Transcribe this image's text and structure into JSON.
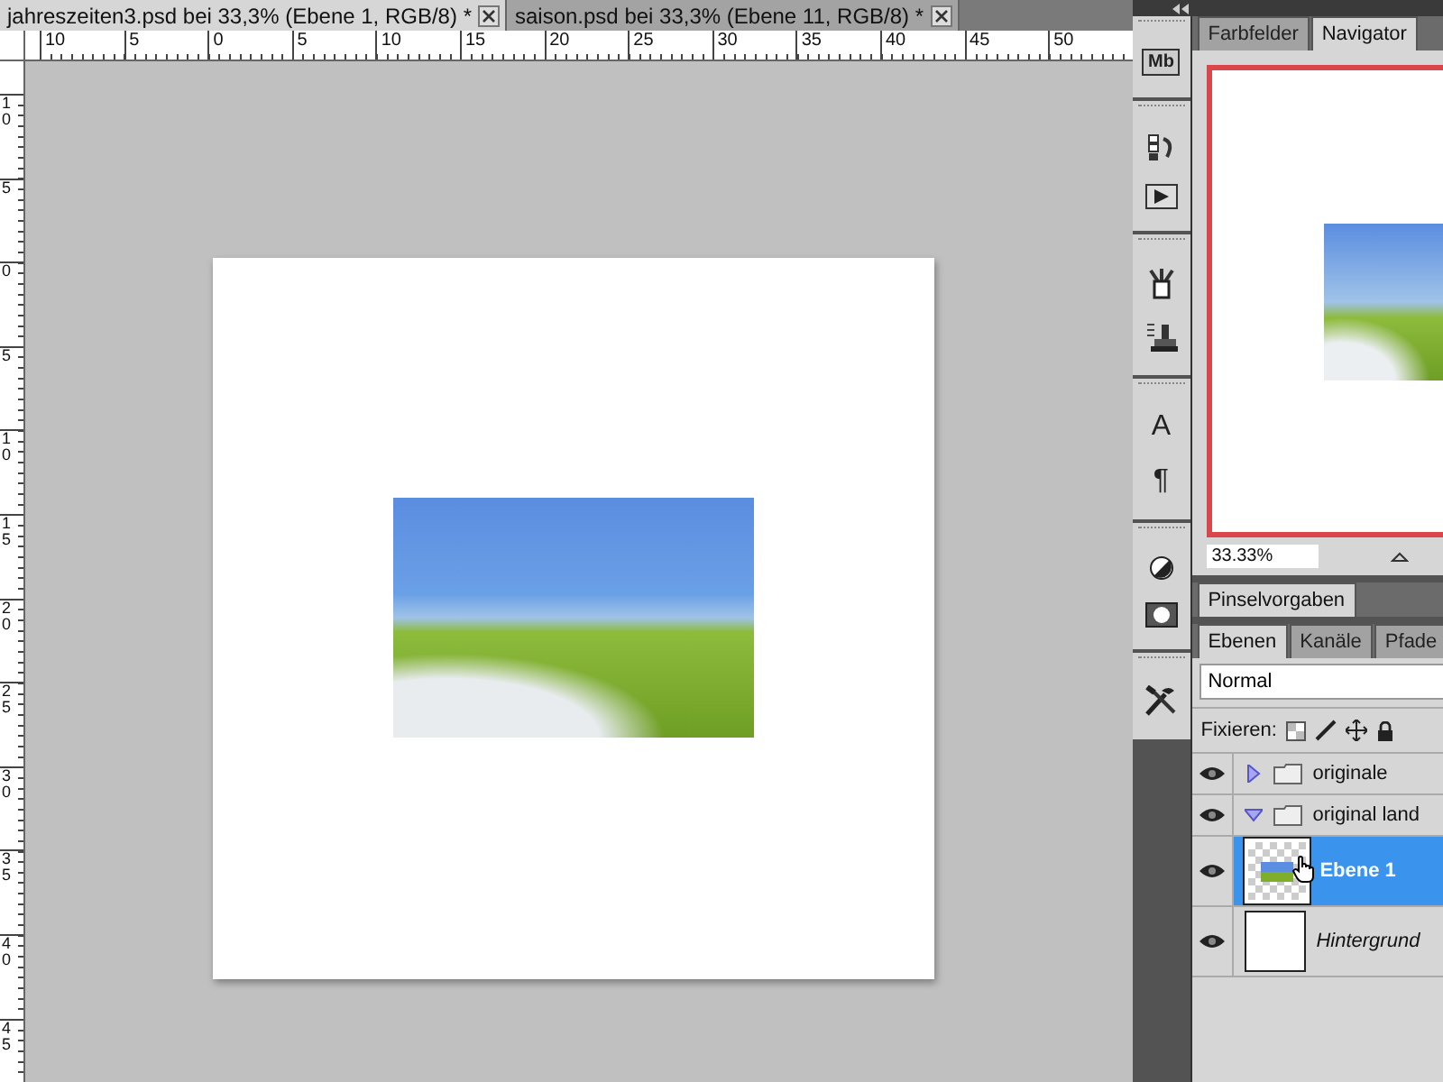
{
  "document_tabs": [
    {
      "title": "jahreszeiten3.psd bei 33,3% (Ebene 1, RGB/8) *",
      "selected": true
    },
    {
      "title": "saison.psd bei 33,3% (Ebene 11, RGB/8) *",
      "selected": false
    }
  ],
  "ruler_top": {
    "labels": [
      "10",
      "5",
      "0",
      "5",
      "10",
      "15",
      "20",
      "25",
      "30",
      "35",
      "40",
      "45",
      "50"
    ]
  },
  "ruler_left": {
    "labels": [
      "10",
      "5",
      "0",
      "5",
      "10",
      "15",
      "20",
      "25",
      "30",
      "35",
      "40",
      "45"
    ]
  },
  "dock": {
    "badge": "Mb",
    "character_glyph": "A",
    "paragraph_glyph": "¶"
  },
  "panel_tabs": [
    {
      "label": "Farbfelder",
      "selected": false
    },
    {
      "label": "Navigator",
      "selected": true
    }
  ],
  "navigator": {
    "zoom": "33.33%"
  },
  "brush_panel": {
    "tab": "Pinselvorgaben"
  },
  "layers_panel": {
    "tabs": [
      {
        "label": "Ebenen",
        "selected": true
      },
      {
        "label": "Kanäle",
        "selected": false
      },
      {
        "label": "Pfade",
        "selected": false
      }
    ],
    "blend_mode": "Normal",
    "lock_label": "Fixieren:",
    "layers": [
      {
        "name": "originale",
        "kind": "group",
        "expanded": false,
        "visible": true,
        "selected": false
      },
      {
        "name": "original land",
        "kind": "group",
        "expanded": true,
        "visible": true,
        "selected": false
      },
      {
        "name": "Ebene 1",
        "kind": "layer",
        "visible": true,
        "selected": true
      },
      {
        "name": "Hintergrund",
        "kind": "background",
        "visible": true,
        "selected": false
      }
    ]
  }
}
